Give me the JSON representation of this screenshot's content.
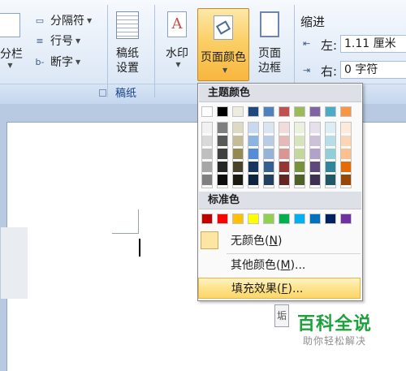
{
  "ribbon": {
    "columns": {
      "label": "分栏"
    },
    "breaks": {
      "label": "分隔符"
    },
    "line_numbers": {
      "label": "行号"
    },
    "hyphenation": {
      "label": "断字"
    },
    "manuscript": {
      "line1": "稿纸",
      "line2": "设置",
      "group_label": "稿纸"
    },
    "watermark": {
      "label": "水印"
    },
    "page_color": {
      "label": "页面颜色"
    },
    "page_borders": {
      "line1": "页面",
      "line2": "边框"
    },
    "indent": {
      "title": "缩进",
      "left_label": "左:",
      "left_value": "1.11 厘米",
      "right_label": "右:",
      "right_value": "0 字符"
    }
  },
  "menu": {
    "theme_colors_header": "主题颜色",
    "standard_colors_header": "标准色",
    "no_color": "无颜色(",
    "no_color_key": "N",
    "no_color_end": ")",
    "more_colors": "其他颜色(",
    "more_colors_key": "M",
    "more_colors_end": ")...",
    "fill_effects": "填充效果(",
    "fill_effects_key": "F",
    "fill_effects_end": ")...",
    "theme_base_colors": [
      "#ffffff",
      "#000000",
      "#eeece1",
      "#1f497d",
      "#4f81bd",
      "#c0504d",
      "#9bbb59",
      "#8064a2",
      "#4bacc6",
      "#f79646"
    ],
    "theme_shades": [
      [
        "#f2f2f2",
        "#d9d9d9",
        "#bfbfbf",
        "#a6a6a6",
        "#808080"
      ],
      [
        "#7f7f7f",
        "#595959",
        "#3f3f3f",
        "#262626",
        "#0d0d0d"
      ],
      [
        "#ddd9c3",
        "#c4bd97",
        "#938953",
        "#494429",
        "#1d1b10"
      ],
      [
        "#c6d9f0",
        "#8db3e2",
        "#548dd4",
        "#17365d",
        "#0f243e"
      ],
      [
        "#dbe5f1",
        "#b8cce4",
        "#95b3d7",
        "#366092",
        "#244061"
      ],
      [
        "#f2dcdb",
        "#e5b9b7",
        "#d99694",
        "#953734",
        "#632423"
      ],
      [
        "#ebf1dd",
        "#d7e3bc",
        "#c3d69b",
        "#76923c",
        "#4f6128"
      ],
      [
        "#e5e0ec",
        "#ccc1d9",
        "#b2a2c7",
        "#5f497a",
        "#3f3151"
      ],
      [
        "#dbeef3",
        "#b7dde8",
        "#92cddc",
        "#31859b",
        "#205867"
      ],
      [
        "#fdeada",
        "#fbd5b5",
        "#fac08f",
        "#e36c09",
        "#974806"
      ]
    ],
    "standard_colors": [
      "#c00000",
      "#ff0000",
      "#ffc000",
      "#ffff00",
      "#92d050",
      "#00b050",
      "#00b0f0",
      "#0070c0",
      "#002060",
      "#7030a0"
    ]
  },
  "document": {
    "paste_tag": "垢"
  },
  "watermark_logo": {
    "title": "百科全说",
    "subtitle": "助你轻松解决"
  }
}
